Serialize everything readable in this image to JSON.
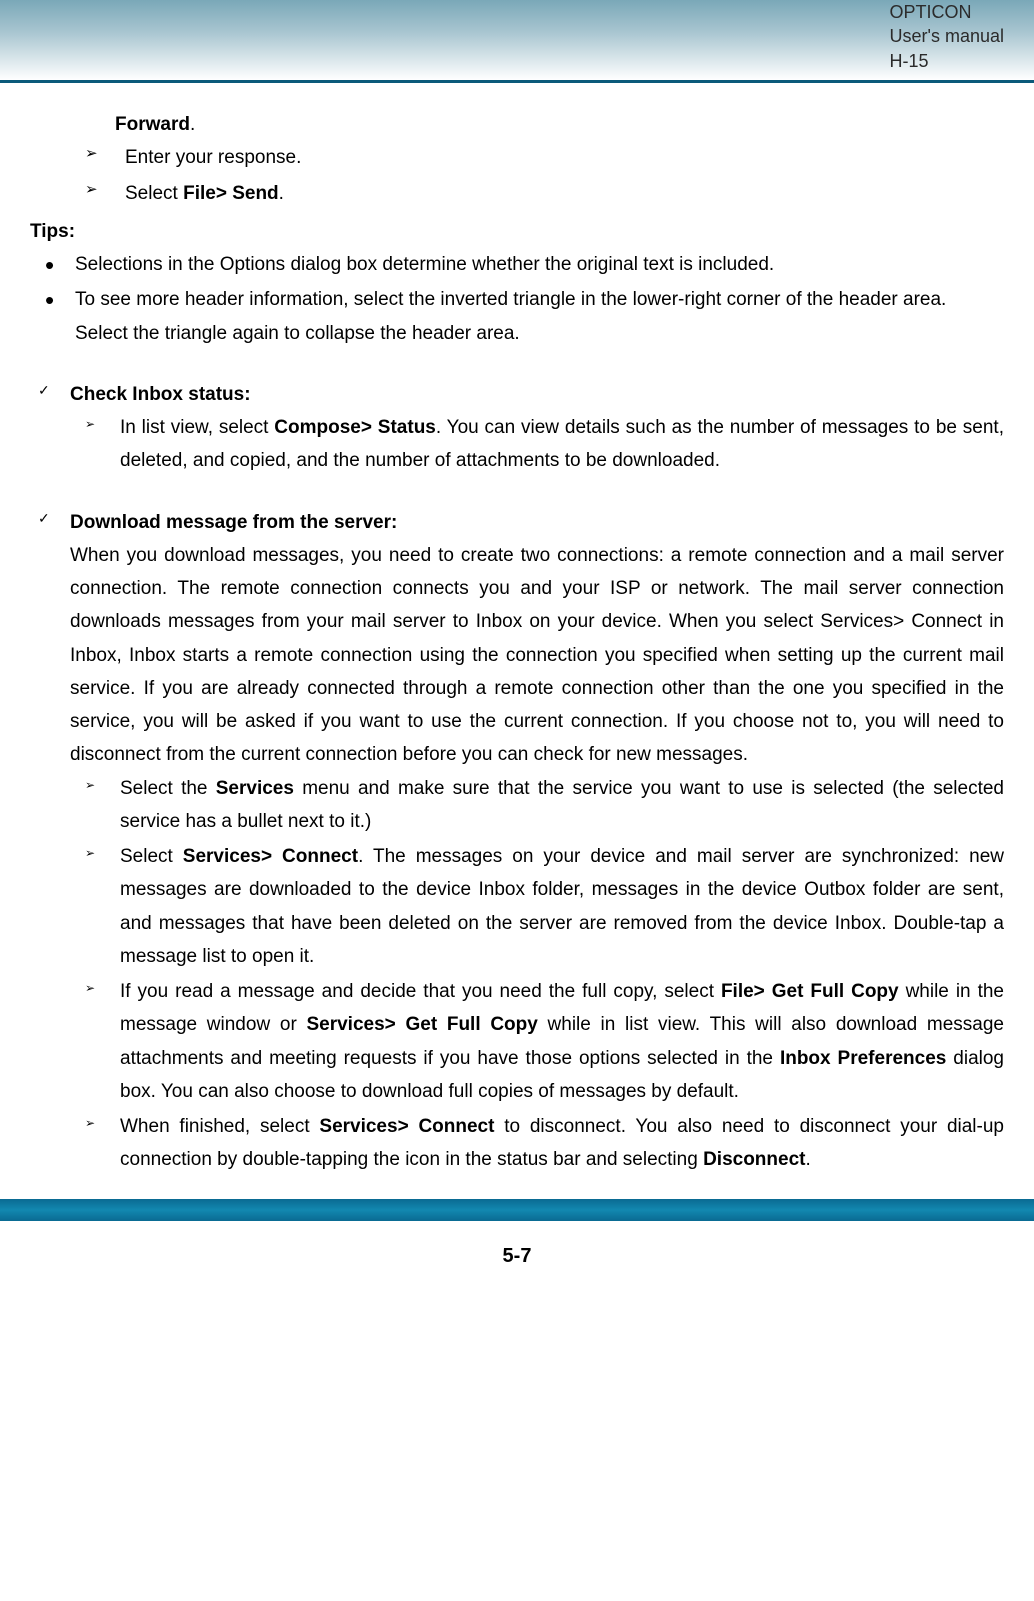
{
  "header": {
    "line1": "OPTICON",
    "line2": "User's manual",
    "line3": "H-15"
  },
  "forward": {
    "label": "Forward",
    "period": "."
  },
  "steps1": {
    "enter": "Enter your response.",
    "select_pre": "Select ",
    "file_send": "File> Send",
    "select_post": "."
  },
  "tips_label": "Tips:",
  "tips": {
    "t1": "Selections in the Options dialog box determine whether the original text is included.",
    "t2": "To see more header information, select the inverted triangle in the lower-right corner of the header area. Select the triangle again to collapse the header area."
  },
  "check1": {
    "heading": "Check Inbox status:",
    "i1_pre": "In list view, select ",
    "i1_b": "Compose> Status",
    "i1_post": ". You can view details such as the number of messages to be sent, deleted, and copied, and the number of attachments to be downloaded."
  },
  "check2": {
    "heading": "Download message from the server:",
    "para": "When you download messages, you need to create two connections: a remote connection and a mail server connection. The remote connection connects you and your ISP or network. The mail server connection downloads messages from your mail server to Inbox on your device. When you select Services> Connect in Inbox, Inbox starts a remote connection using the connection you specified when setting up the current mail service. If you are already connected through a remote connection other than the one you specified in the service, you will be asked if you want to use the current connection. If you choose not to, you will need to disconnect from the current connection before you can check for new messages.",
    "s1_pre": "Select the ",
    "s1_b": "Services",
    "s1_post": " menu and make sure that the service you want to use is selected (the selected service has a bullet next to it.)",
    "s2_pre": "Select ",
    "s2_b": "Services> Connect",
    "s2_post": ". The messages on your device and mail server are synchronized: new messages are downloaded to the device Inbox folder, messages in the device Outbox folder are sent, and messages that have been deleted on the server are removed from the device Inbox. Double-tap a message list to open it.",
    "s3_pre": "If you read a message and decide that you need the full copy, select ",
    "s3_b1": "File> Get Full Copy",
    "s3_mid1": " while in the message window or ",
    "s3_b2": "Services> Get Full Copy",
    "s3_mid2": " while in list view. This will also download message attachments and meeting requests if you have those options selected in the ",
    "s3_b3": "Inbox Preferences",
    "s3_post": " dialog box. You can also choose to download full copies of messages by default.",
    "s4_pre": "When finished, select ",
    "s4_b": "Services> Connect",
    "s4_mid": " to disconnect. You also need to disconnect your dial-up connection by double-tapping the icon in the status bar and selecting ",
    "s4_b2": "Disconnect",
    "s4_post": "."
  },
  "page_num": "5-7"
}
